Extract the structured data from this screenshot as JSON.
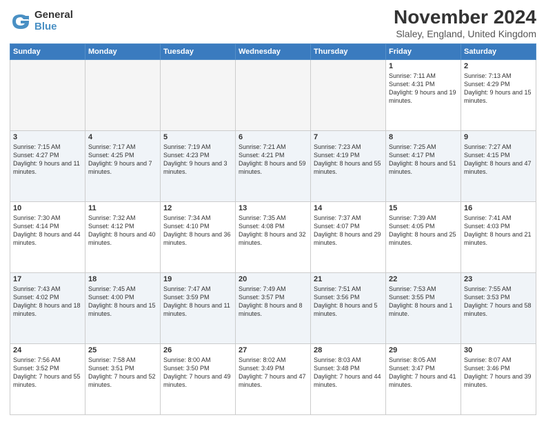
{
  "logo": {
    "general": "General",
    "blue": "Blue"
  },
  "title": "November 2024",
  "location": "Slaley, England, United Kingdom",
  "days_of_week": [
    "Sunday",
    "Monday",
    "Tuesday",
    "Wednesday",
    "Thursday",
    "Friday",
    "Saturday"
  ],
  "weeks": [
    [
      {
        "day": "",
        "info": ""
      },
      {
        "day": "",
        "info": ""
      },
      {
        "day": "",
        "info": ""
      },
      {
        "day": "",
        "info": ""
      },
      {
        "day": "",
        "info": ""
      },
      {
        "day": "1",
        "info": "Sunrise: 7:11 AM\nSunset: 4:31 PM\nDaylight: 9 hours and 19 minutes."
      },
      {
        "day": "2",
        "info": "Sunrise: 7:13 AM\nSunset: 4:29 PM\nDaylight: 9 hours and 15 minutes."
      }
    ],
    [
      {
        "day": "3",
        "info": "Sunrise: 7:15 AM\nSunset: 4:27 PM\nDaylight: 9 hours and 11 minutes."
      },
      {
        "day": "4",
        "info": "Sunrise: 7:17 AM\nSunset: 4:25 PM\nDaylight: 9 hours and 7 minutes."
      },
      {
        "day": "5",
        "info": "Sunrise: 7:19 AM\nSunset: 4:23 PM\nDaylight: 9 hours and 3 minutes."
      },
      {
        "day": "6",
        "info": "Sunrise: 7:21 AM\nSunset: 4:21 PM\nDaylight: 8 hours and 59 minutes."
      },
      {
        "day": "7",
        "info": "Sunrise: 7:23 AM\nSunset: 4:19 PM\nDaylight: 8 hours and 55 minutes."
      },
      {
        "day": "8",
        "info": "Sunrise: 7:25 AM\nSunset: 4:17 PM\nDaylight: 8 hours and 51 minutes."
      },
      {
        "day": "9",
        "info": "Sunrise: 7:27 AM\nSunset: 4:15 PM\nDaylight: 8 hours and 47 minutes."
      }
    ],
    [
      {
        "day": "10",
        "info": "Sunrise: 7:30 AM\nSunset: 4:14 PM\nDaylight: 8 hours and 44 minutes."
      },
      {
        "day": "11",
        "info": "Sunrise: 7:32 AM\nSunset: 4:12 PM\nDaylight: 8 hours and 40 minutes."
      },
      {
        "day": "12",
        "info": "Sunrise: 7:34 AM\nSunset: 4:10 PM\nDaylight: 8 hours and 36 minutes."
      },
      {
        "day": "13",
        "info": "Sunrise: 7:35 AM\nSunset: 4:08 PM\nDaylight: 8 hours and 32 minutes."
      },
      {
        "day": "14",
        "info": "Sunrise: 7:37 AM\nSunset: 4:07 PM\nDaylight: 8 hours and 29 minutes."
      },
      {
        "day": "15",
        "info": "Sunrise: 7:39 AM\nSunset: 4:05 PM\nDaylight: 8 hours and 25 minutes."
      },
      {
        "day": "16",
        "info": "Sunrise: 7:41 AM\nSunset: 4:03 PM\nDaylight: 8 hours and 21 minutes."
      }
    ],
    [
      {
        "day": "17",
        "info": "Sunrise: 7:43 AM\nSunset: 4:02 PM\nDaylight: 8 hours and 18 minutes."
      },
      {
        "day": "18",
        "info": "Sunrise: 7:45 AM\nSunset: 4:00 PM\nDaylight: 8 hours and 15 minutes."
      },
      {
        "day": "19",
        "info": "Sunrise: 7:47 AM\nSunset: 3:59 PM\nDaylight: 8 hours and 11 minutes."
      },
      {
        "day": "20",
        "info": "Sunrise: 7:49 AM\nSunset: 3:57 PM\nDaylight: 8 hours and 8 minutes."
      },
      {
        "day": "21",
        "info": "Sunrise: 7:51 AM\nSunset: 3:56 PM\nDaylight: 8 hours and 5 minutes."
      },
      {
        "day": "22",
        "info": "Sunrise: 7:53 AM\nSunset: 3:55 PM\nDaylight: 8 hours and 1 minute."
      },
      {
        "day": "23",
        "info": "Sunrise: 7:55 AM\nSunset: 3:53 PM\nDaylight: 7 hours and 58 minutes."
      }
    ],
    [
      {
        "day": "24",
        "info": "Sunrise: 7:56 AM\nSunset: 3:52 PM\nDaylight: 7 hours and 55 minutes."
      },
      {
        "day": "25",
        "info": "Sunrise: 7:58 AM\nSunset: 3:51 PM\nDaylight: 7 hours and 52 minutes."
      },
      {
        "day": "26",
        "info": "Sunrise: 8:00 AM\nSunset: 3:50 PM\nDaylight: 7 hours and 49 minutes."
      },
      {
        "day": "27",
        "info": "Sunrise: 8:02 AM\nSunset: 3:49 PM\nDaylight: 7 hours and 47 minutes."
      },
      {
        "day": "28",
        "info": "Sunrise: 8:03 AM\nSunset: 3:48 PM\nDaylight: 7 hours and 44 minutes."
      },
      {
        "day": "29",
        "info": "Sunrise: 8:05 AM\nSunset: 3:47 PM\nDaylight: 7 hours and 41 minutes."
      },
      {
        "day": "30",
        "info": "Sunrise: 8:07 AM\nSunset: 3:46 PM\nDaylight: 7 hours and 39 minutes."
      }
    ]
  ]
}
